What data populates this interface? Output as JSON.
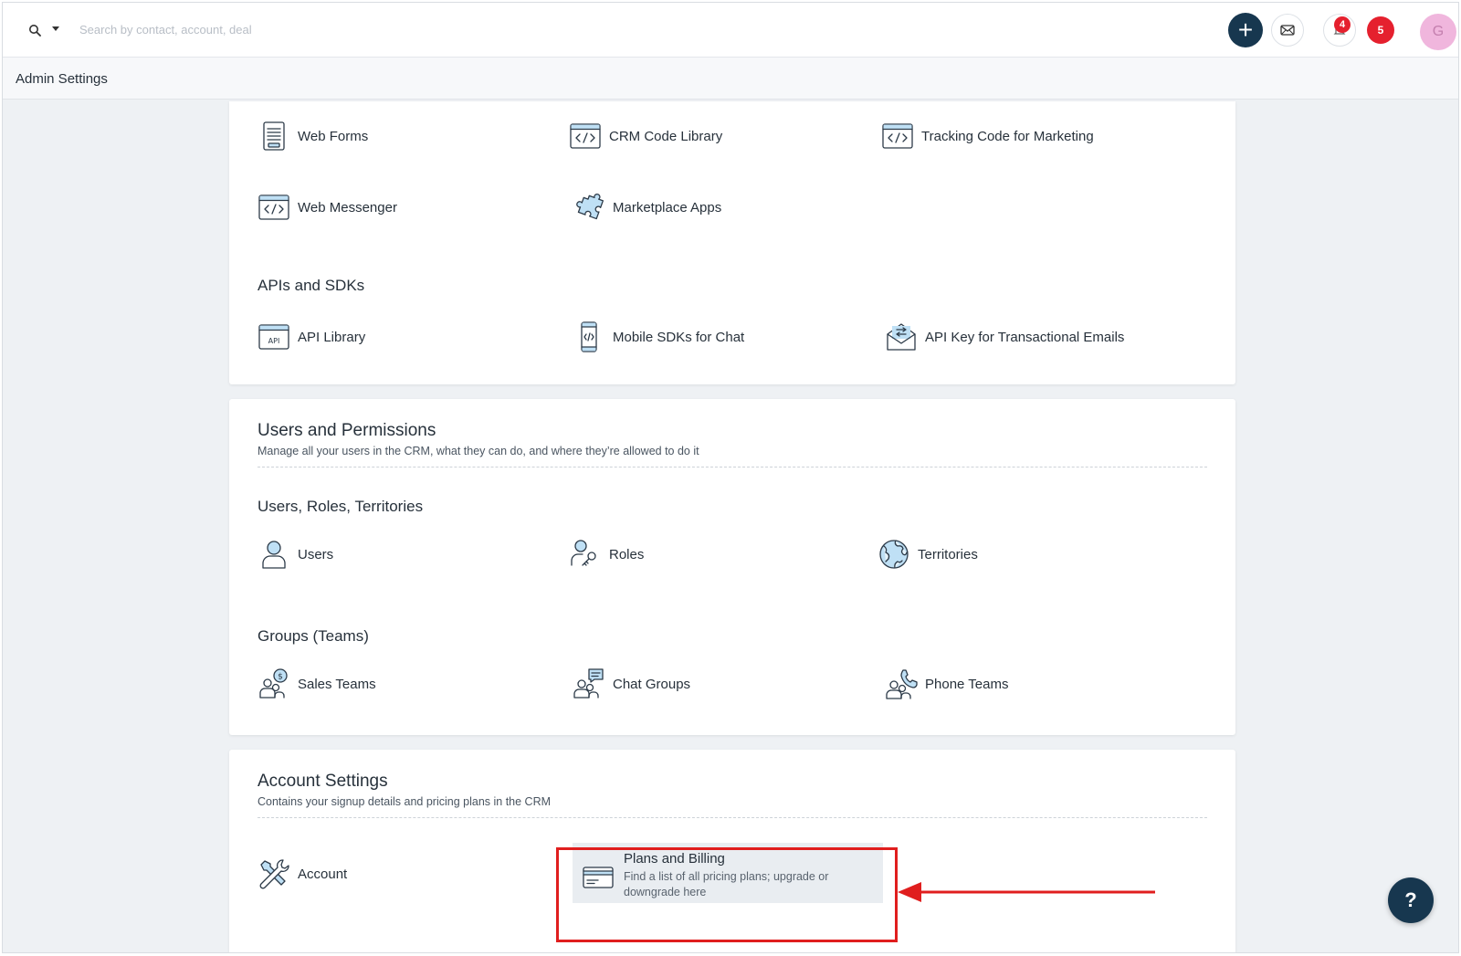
{
  "topbar": {
    "search_placeholder": "Search by contact, account, deal",
    "add_label": "+",
    "notifications_count": "4",
    "alerts_count": "5",
    "avatar_initial": "G"
  },
  "subheader": {
    "title": "Admin Settings"
  },
  "integrations": {
    "items": [
      {
        "label": "Web Forms",
        "icon": "form-icon"
      },
      {
        "label": "CRM Code Library",
        "icon": "code-window-icon"
      },
      {
        "label": "Tracking Code for Marketing",
        "icon": "code-window-icon"
      },
      {
        "label": "Web Messenger",
        "icon": "code-window-icon"
      },
      {
        "label": "Marketplace Apps",
        "icon": "puzzle-icon"
      }
    ]
  },
  "apis": {
    "title": "APIs and SDKs",
    "items": [
      {
        "label": "API Library",
        "icon": "api-window-icon"
      },
      {
        "label": "Mobile SDKs for Chat",
        "icon": "mobile-code-icon"
      },
      {
        "label": "API Key for Transactional Emails",
        "icon": "envelope-key-icon"
      }
    ]
  },
  "users_permissions": {
    "title": "Users and Permissions",
    "subtitle": "Manage all your users in the CRM, what they can do, and where they’re allowed to do it",
    "group1": {
      "title": "Users, Roles, Territories",
      "items": [
        {
          "label": "Users",
          "icon": "user-icon"
        },
        {
          "label": "Roles",
          "icon": "user-key-icon"
        },
        {
          "label": "Territories",
          "icon": "globe-icon"
        }
      ]
    },
    "group2": {
      "title": "Groups (Teams)",
      "items": [
        {
          "label": "Sales Teams",
          "icon": "sales-team-icon"
        },
        {
          "label": "Chat Groups",
          "icon": "chat-group-icon"
        },
        {
          "label": "Phone Teams",
          "icon": "phone-team-icon"
        }
      ]
    }
  },
  "account_settings": {
    "title": "Account Settings",
    "subtitle": "Contains your signup details and pricing plans in the CRM",
    "account_label": "Account",
    "plans_title": "Plans and Billing",
    "plans_desc_line1": "Find a list of all pricing plans; upgrade or",
    "plans_desc_line2": "downgrade here"
  },
  "help_label": "?",
  "colors": {
    "primary_dark": "#17374f",
    "badge_red": "#e5202e",
    "highlight_red": "#e01e1e",
    "icon_fill": "#bfe0f5"
  }
}
